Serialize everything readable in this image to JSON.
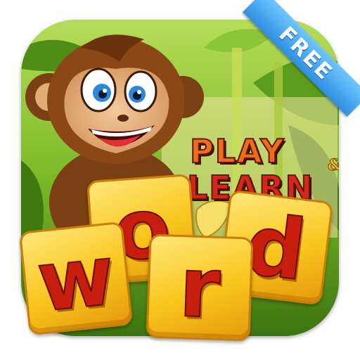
{
  "app_icon": {
    "title_line1": "PLAY",
    "title_amp": "&",
    "title_line2": "LEARN",
    "ribbon_label": "FREE",
    "tiles": [
      "w",
      "o",
      "r",
      "d"
    ],
    "colors": {
      "ribbon": "#2f8fe0",
      "play_text": "#f26a1b",
      "learn_text": "#d8261c",
      "tile": "#f9c51c",
      "tile_letter": "#c81e0e",
      "background": "#6fae1e"
    },
    "icons": [
      "monkey-mascot-icon",
      "banana-icon",
      "jungle-leaves-icon"
    ]
  }
}
